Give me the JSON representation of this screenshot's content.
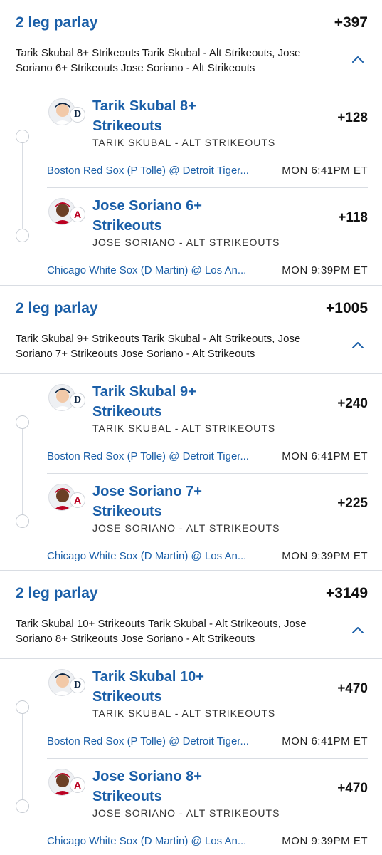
{
  "colors": {
    "accent": "#1b5fa8",
    "divider": "#d9dde3",
    "tigers_navy": "#0c2340",
    "angels_red": "#ba0021"
  },
  "parlays": [
    {
      "title": "2 leg parlay",
      "odds": "+397",
      "description": "Tarik Skubal 8+ Strikeouts Tarik Skubal - Alt Strikeouts, Jose Soriano 6+ Strikeouts Jose Soriano - Alt Strikeouts",
      "chevron_icon": "chevron-up-icon",
      "legs": [
        {
          "name": "Tarik Skubal 8+ Strikeouts",
          "market": "TARIK SKUBAL - ALT STRIKEOUTS",
          "odds": "+128",
          "game": "Boston Red Sox (P Tolle) @ Detroit Tiger...",
          "time": "MON 6:41PM ET",
          "team_icon": "tigers-logo-icon",
          "team_glyph": "D"
        },
        {
          "name": "Jose Soriano 6+ Strikeouts",
          "market": "JOSE SORIANO - ALT STRIKEOUTS",
          "odds": "+118",
          "game": "Chicago White Sox (D Martin) @ Los An...",
          "time": "MON 9:39PM ET",
          "team_icon": "angels-logo-icon",
          "team_glyph": "A"
        }
      ]
    },
    {
      "title": "2 leg parlay",
      "odds": "+1005",
      "description": "Tarik Skubal 9+ Strikeouts Tarik Skubal - Alt Strikeouts, Jose Soriano 7+ Strikeouts Jose Soriano - Alt Strikeouts",
      "chevron_icon": "chevron-up-icon",
      "legs": [
        {
          "name": "Tarik Skubal 9+ Strikeouts",
          "market": "TARIK SKUBAL - ALT STRIKEOUTS",
          "odds": "+240",
          "game": "Boston Red Sox (P Tolle) @ Detroit Tiger...",
          "time": "MON 6:41PM ET",
          "team_icon": "tigers-logo-icon",
          "team_glyph": "D"
        },
        {
          "name": "Jose Soriano 7+ Strikeouts",
          "market": "JOSE SORIANO - ALT STRIKEOUTS",
          "odds": "+225",
          "game": "Chicago White Sox (D Martin) @ Los An...",
          "time": "MON 9:39PM ET",
          "team_icon": "angels-logo-icon",
          "team_glyph": "A"
        }
      ]
    },
    {
      "title": "2 leg parlay",
      "odds": "+3149",
      "description": "Tarik Skubal 10+ Strikeouts Tarik Skubal - Alt Strikeouts, Jose Soriano 8+ Strikeouts Jose Soriano - Alt Strikeouts",
      "chevron_icon": "chevron-up-icon",
      "legs": [
        {
          "name": "Tarik Skubal 10+ Strikeouts",
          "market": "TARIK SKUBAL - ALT STRIKEOUTS",
          "odds": "+470",
          "game": "Boston Red Sox (P Tolle) @ Detroit Tiger...",
          "time": "MON 6:41PM ET",
          "team_icon": "tigers-logo-icon",
          "team_glyph": "D"
        },
        {
          "name": "Jose Soriano 8+ Strikeouts",
          "market": "JOSE SORIANO - ALT STRIKEOUTS",
          "odds": "+470",
          "game": "Chicago White Sox (D Martin) @ Los An...",
          "time": "MON 9:39PM ET",
          "team_icon": "angels-logo-icon",
          "team_glyph": "A"
        }
      ]
    }
  ]
}
